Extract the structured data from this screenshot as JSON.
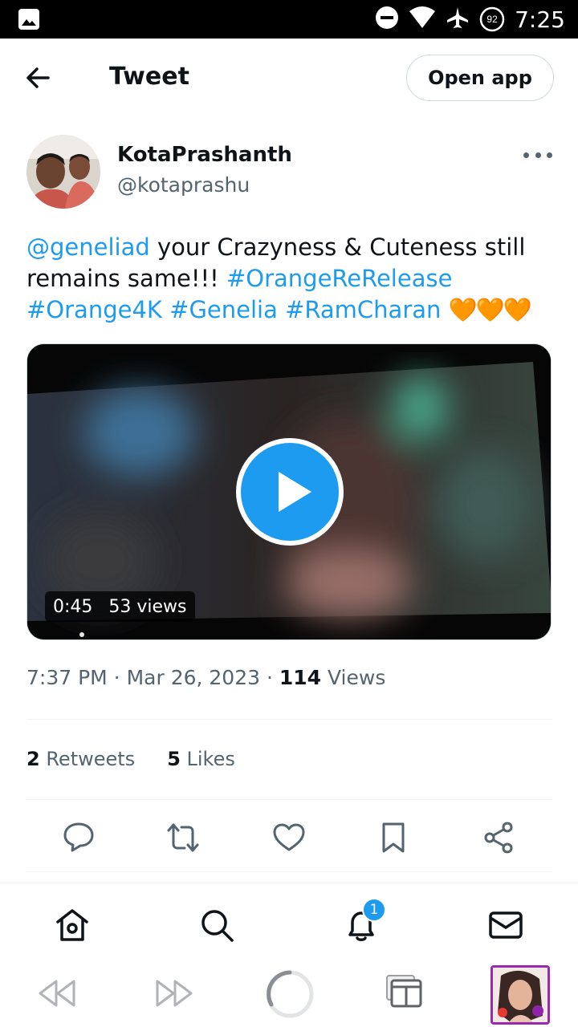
{
  "status_bar": {
    "time": "7:25",
    "battery": "92",
    "icons": [
      "gallery-icon",
      "do-not-disturb-icon",
      "wifi-icon",
      "airplane-mode-icon",
      "battery-icon"
    ]
  },
  "header": {
    "back_icon": "arrow-left-icon",
    "title": "Tweet",
    "open_app_label": "Open app"
  },
  "tweet": {
    "author_name": "KotaPrashanth",
    "author_handle": "@kotaprashu",
    "mention": "@geneliad",
    "text_1": " your Crazyness & Cuteness still remains same!!! ",
    "hashtag_1": "#OrangeReRelease",
    "hashtag_2": "#Orange4K",
    "hashtag_3": "#Genelia",
    "hashtag_4": "#RamCharan",
    "emojis": "🧡🧡🧡",
    "video": {
      "duration": "0:45",
      "views": "53 views"
    },
    "time": "7:37 PM",
    "sep_1": " · ",
    "date": "Mar 26, 2023",
    "sep_2": " · ",
    "view_count": "114",
    "views_label": " Views",
    "retweets_count": "2",
    "retweets_label": " Retweets",
    "likes_count": "5",
    "likes_label": " Likes"
  },
  "actions": [
    "reply-icon",
    "retweet-icon",
    "like-icon",
    "bookmark-icon",
    "share-icon"
  ],
  "bottom_nav": {
    "items": [
      "home-icon",
      "search-icon",
      "notifications-icon",
      "messages-icon"
    ],
    "notification_count": "1"
  },
  "colors": {
    "accent": "#1d9bf0",
    "text_primary": "#0f1419",
    "text_secondary": "#536471",
    "heart_orange": "#f4900c"
  }
}
